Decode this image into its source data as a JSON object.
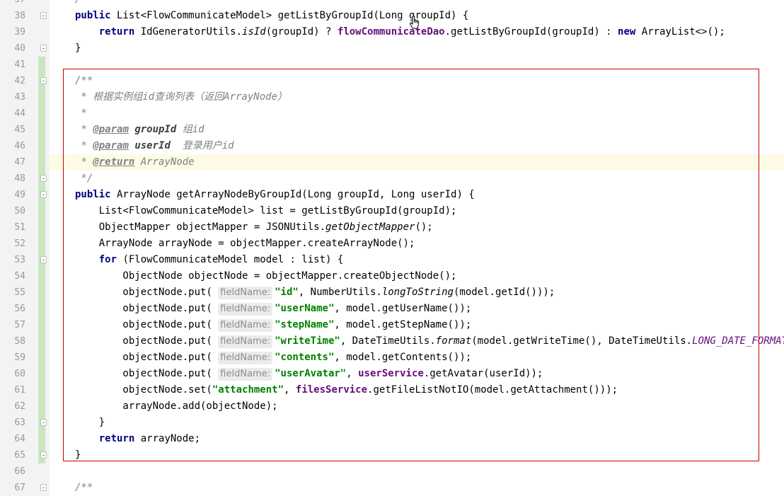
{
  "editor": {
    "lines": [
      {
        "n": "37",
        "fold": false,
        "change": false,
        "tokens": [
          {
            "t": "/",
            "c": "cm"
          }
        ]
      },
      {
        "n": "38",
        "fold": true,
        "change": false,
        "tokens": [
          {
            "t": "public",
            "c": "kw"
          },
          {
            "t": " List<FlowCommunicateModel> getListByGroupId(Long groupId) {"
          }
        ]
      },
      {
        "n": "39",
        "fold": false,
        "change": false,
        "tokens": [
          {
            "t": "    "
          },
          {
            "t": "return",
            "c": "kw"
          },
          {
            "t": " IdGeneratorUtils."
          },
          {
            "t": "isId",
            "c": "st"
          },
          {
            "t": "(groupId) ? "
          },
          {
            "t": "flowCommunicateDao",
            "c": "fld"
          },
          {
            "t": ".getListByGroupId(groupId) : "
          },
          {
            "t": "new",
            "c": "kw"
          },
          {
            "t": " ArrayList<>();"
          }
        ]
      },
      {
        "n": "40",
        "fold": true,
        "change": false,
        "tokens": [
          {
            "t": "}"
          }
        ]
      },
      {
        "n": "41",
        "fold": false,
        "change": true,
        "tokens": []
      },
      {
        "n": "42",
        "fold": true,
        "change": true,
        "tokens": [
          {
            "t": "/**",
            "c": "cm"
          }
        ]
      },
      {
        "n": "43",
        "fold": false,
        "change": true,
        "tokens": [
          {
            "t": " * 根据实例组id查询列表（返回ArrayNode）",
            "c": "cm"
          }
        ]
      },
      {
        "n": "44",
        "fold": false,
        "change": true,
        "tokens": [
          {
            "t": " *",
            "c": "cm"
          }
        ]
      },
      {
        "n": "45",
        "fold": false,
        "change": true,
        "tokens": [
          {
            "t": " * ",
            "c": "cm"
          },
          {
            "t": "@param",
            "c": "tag"
          },
          {
            "t": " "
          },
          {
            "t": "groupId",
            "c": "pn"
          },
          {
            "t": " 组id",
            "c": "cm"
          }
        ]
      },
      {
        "n": "46",
        "fold": false,
        "change": true,
        "tokens": [
          {
            "t": " * ",
            "c": "cm"
          },
          {
            "t": "@param",
            "c": "tag"
          },
          {
            "t": " "
          },
          {
            "t": "userId",
            "c": "pn"
          },
          {
            "t": "  登录用户id",
            "c": "cm"
          }
        ]
      },
      {
        "n": "47",
        "fold": false,
        "change": true,
        "current": true,
        "tokens": [
          {
            "t": " * ",
            "c": "cm"
          },
          {
            "t": "@return",
            "c": "tag"
          },
          {
            "t": " ArrayNode",
            "c": "cm"
          }
        ]
      },
      {
        "n": "48",
        "fold": true,
        "change": true,
        "tokens": [
          {
            "t": " */",
            "c": "cm"
          }
        ]
      },
      {
        "n": "49",
        "fold": true,
        "change": true,
        "tokens": [
          {
            "t": "public",
            "c": "kw"
          },
          {
            "t": " ArrayNode getArrayNodeByGroupId(Long groupId, Long userId) {"
          }
        ]
      },
      {
        "n": "50",
        "fold": false,
        "change": true,
        "tokens": [
          {
            "t": "    List<FlowCommunicateModel> list = getListByGroupId(groupId);"
          }
        ]
      },
      {
        "n": "51",
        "fold": false,
        "change": true,
        "tokens": [
          {
            "t": "    ObjectMapper objectMapper = JSONUtils."
          },
          {
            "t": "getObjectMapper",
            "c": "st"
          },
          {
            "t": "();"
          }
        ]
      },
      {
        "n": "52",
        "fold": false,
        "change": true,
        "tokens": [
          {
            "t": "    ArrayNode arrayNode = objectMapper.createArrayNode();"
          }
        ]
      },
      {
        "n": "53",
        "fold": true,
        "change": true,
        "tokens": [
          {
            "t": "    "
          },
          {
            "t": "for",
            "c": "kw"
          },
          {
            "t": " (FlowCommunicateModel model : list) {"
          }
        ]
      },
      {
        "n": "54",
        "fold": false,
        "change": true,
        "tokens": [
          {
            "t": "        ObjectNode objectNode = objectMapper.createObjectNode();"
          }
        ]
      },
      {
        "n": "55",
        "fold": false,
        "change": true,
        "tokens": [
          {
            "t": "        objectNode.put( "
          },
          {
            "t": "fieldName:",
            "c": "hint"
          },
          {
            "t": "\"id\"",
            "c": "str"
          },
          {
            "t": ", NumberUtils."
          },
          {
            "t": "longToString",
            "c": "st"
          },
          {
            "t": "(model.getId()));"
          }
        ]
      },
      {
        "n": "56",
        "fold": false,
        "change": true,
        "tokens": [
          {
            "t": "        objectNode.put( "
          },
          {
            "t": "fieldName:",
            "c": "hint"
          },
          {
            "t": "\"userName\"",
            "c": "str"
          },
          {
            "t": ", model.getUserName());"
          }
        ]
      },
      {
        "n": "57",
        "fold": false,
        "change": true,
        "tokens": [
          {
            "t": "        objectNode.put( "
          },
          {
            "t": "fieldName:",
            "c": "hint"
          },
          {
            "t": "\"stepName\"",
            "c": "str"
          },
          {
            "t": ", model.getStepName());"
          }
        ]
      },
      {
        "n": "58",
        "fold": false,
        "change": true,
        "tokens": [
          {
            "t": "        objectNode.put( "
          },
          {
            "t": "fieldName:",
            "c": "hint"
          },
          {
            "t": "\"writeTime\"",
            "c": "str"
          },
          {
            "t": ", DateTimeUtils."
          },
          {
            "t": "format",
            "c": "st"
          },
          {
            "t": "(model.getWriteTime(), DateTimeUtils."
          },
          {
            "t": "LONG_DATE_FORMAT",
            "c": "sfld"
          }
        ]
      },
      {
        "n": "59",
        "fold": false,
        "change": true,
        "tokens": [
          {
            "t": "        objectNode.put( "
          },
          {
            "t": "fieldName:",
            "c": "hint"
          },
          {
            "t": "\"contents\"",
            "c": "str"
          },
          {
            "t": ", model.getContents());"
          }
        ]
      },
      {
        "n": "60",
        "fold": false,
        "change": true,
        "tokens": [
          {
            "t": "        objectNode.put( "
          },
          {
            "t": "fieldName:",
            "c": "hint"
          },
          {
            "t": "\"userAvatar\"",
            "c": "str"
          },
          {
            "t": ", "
          },
          {
            "t": "userService",
            "c": "fld"
          },
          {
            "t": ".getAvatar(userId));"
          }
        ]
      },
      {
        "n": "61",
        "fold": false,
        "change": true,
        "tokens": [
          {
            "t": "        objectNode.set("
          },
          {
            "t": "\"attachment\"",
            "c": "str"
          },
          {
            "t": ", "
          },
          {
            "t": "filesService",
            "c": "fld"
          },
          {
            "t": ".getFileListNotIO(model.getAttachment()));"
          }
        ]
      },
      {
        "n": "62",
        "fold": false,
        "change": true,
        "tokens": [
          {
            "t": "        arrayNode.add(objectNode);"
          }
        ]
      },
      {
        "n": "63",
        "fold": true,
        "change": true,
        "tokens": [
          {
            "t": "    }"
          }
        ]
      },
      {
        "n": "64",
        "fold": false,
        "change": true,
        "tokens": [
          {
            "t": "    "
          },
          {
            "t": "return",
            "c": "kw"
          },
          {
            "t": " arrayNode;"
          }
        ]
      },
      {
        "n": "65",
        "fold": true,
        "change": true,
        "tokens": [
          {
            "t": "}"
          }
        ]
      },
      {
        "n": "66",
        "fold": false,
        "change": false,
        "tokens": []
      },
      {
        "n": "67",
        "fold": true,
        "change": false,
        "tokens": [
          {
            "t": "/**",
            "c": "cm"
          }
        ]
      }
    ]
  }
}
